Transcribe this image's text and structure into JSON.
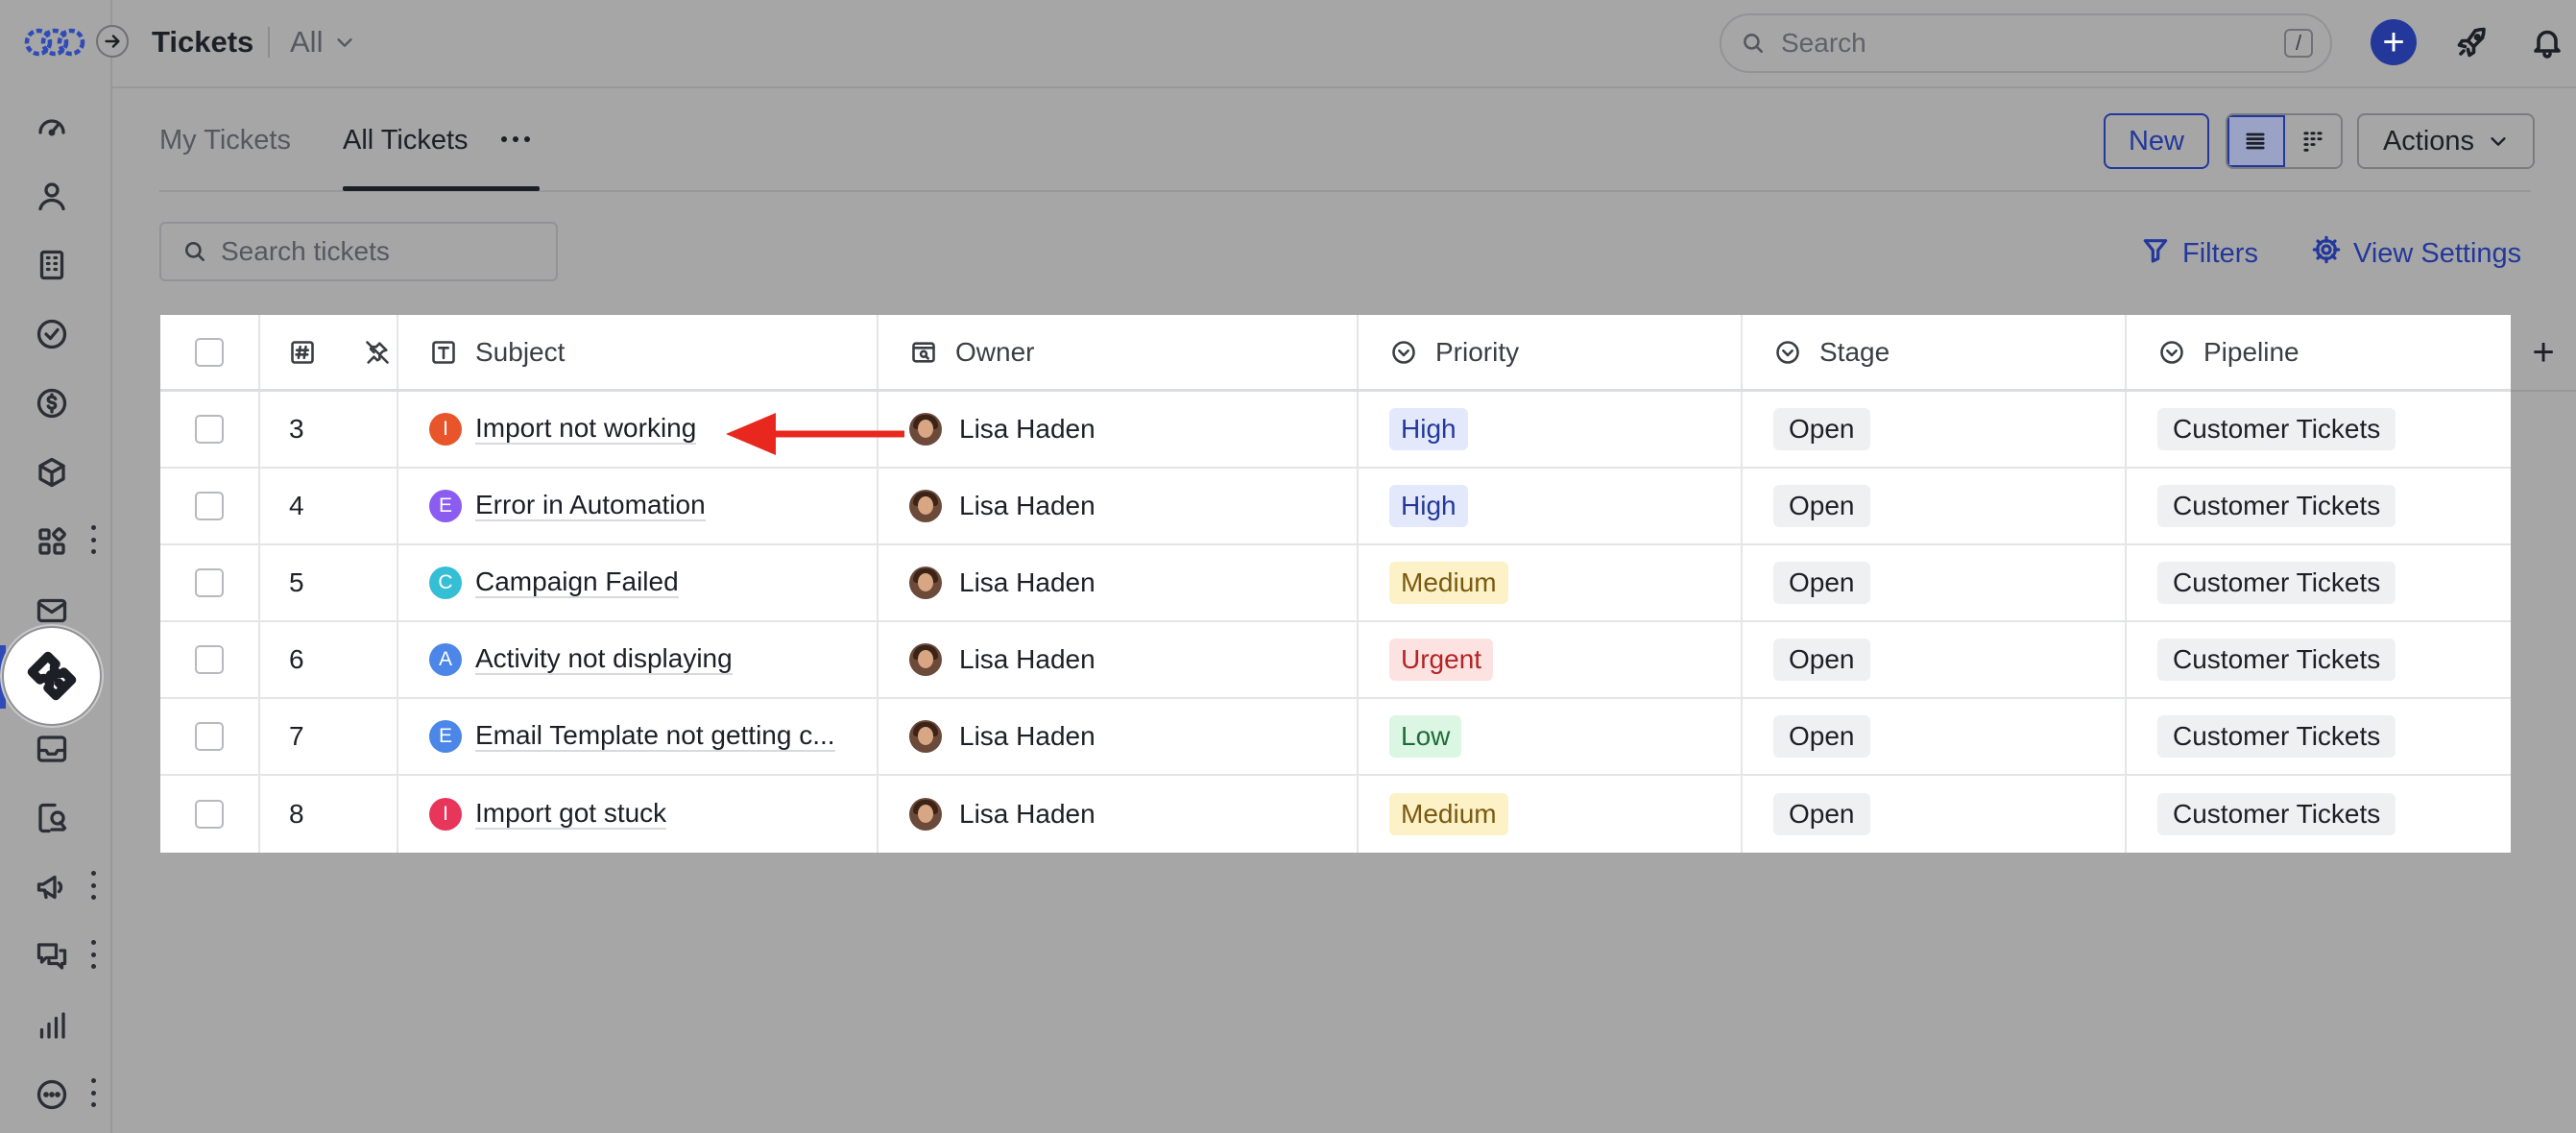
{
  "header": {
    "title": "Tickets",
    "view_select": "All",
    "search_placeholder": "Search",
    "search_shortcut": "/"
  },
  "tabs": [
    {
      "label": "My Tickets",
      "active": false
    },
    {
      "label": "All Tickets",
      "active": true
    }
  ],
  "toolbar": {
    "new_label": "New",
    "actions_label": "Actions",
    "ticket_search_placeholder": "Search tickets",
    "filters_label": "Filters",
    "view_settings_label": "View Settings"
  },
  "table": {
    "columns": [
      "#",
      "Subject",
      "Owner",
      "Priority",
      "Stage",
      "Pipeline"
    ],
    "rows": [
      {
        "id": "3",
        "letter": "I",
        "letter_color": "#e8552a",
        "subject": "Import not working",
        "owner": "Lisa Haden",
        "priority": "High",
        "stage": "Open",
        "pipeline": "Customer Tickets"
      },
      {
        "id": "4",
        "letter": "E",
        "letter_color": "#8b5cf0",
        "subject": "Error in Automation",
        "owner": "Lisa Haden",
        "priority": "High",
        "stage": "Open",
        "pipeline": "Customer Tickets"
      },
      {
        "id": "5",
        "letter": "C",
        "letter_color": "#35bfd4",
        "subject": "Campaign Failed",
        "owner": "Lisa Haden",
        "priority": "Medium",
        "stage": "Open",
        "pipeline": "Customer Tickets"
      },
      {
        "id": "6",
        "letter": "A",
        "letter_color": "#4b86e8",
        "subject": "Activity not displaying",
        "owner": "Lisa Haden",
        "priority": "Urgent",
        "stage": "Open",
        "pipeline": "Customer Tickets"
      },
      {
        "id": "7",
        "letter": "E",
        "letter_color": "#4b86e8",
        "subject": "Email Template not getting c...",
        "owner": "Lisa Haden",
        "priority": "Low",
        "stage": "Open",
        "pipeline": "Customer Tickets"
      },
      {
        "id": "8",
        "letter": "I",
        "letter_color": "#e8365a",
        "subject": "Import got stuck",
        "owner": "Lisa Haden",
        "priority": "Medium",
        "stage": "Open",
        "pipeline": "Customer Tickets"
      }
    ]
  },
  "priority_colors": {
    "High": {
      "bg": "#e3e9fb",
      "fg": "#23389a"
    },
    "Medium": {
      "bg": "#fdf1c7",
      "fg": "#7a5a10"
    },
    "Urgent": {
      "bg": "#fde2e2",
      "fg": "#b42323"
    },
    "Low": {
      "bg": "#dcf6e4",
      "fg": "#1f6b37"
    }
  },
  "accent_color": "#23389a",
  "annotation_color": "#e8281e",
  "sidebar_icons": [
    "dashboard-icon",
    "contacts-icon",
    "companies-icon",
    "tasks-icon",
    "deals-icon",
    "products-icon",
    "apps-icon",
    "mail-icon",
    "tickets-icon",
    "inbox-icon",
    "reports-icon",
    "campaigns-icon",
    "chat-icon",
    "analytics-icon",
    "more-icon"
  ]
}
